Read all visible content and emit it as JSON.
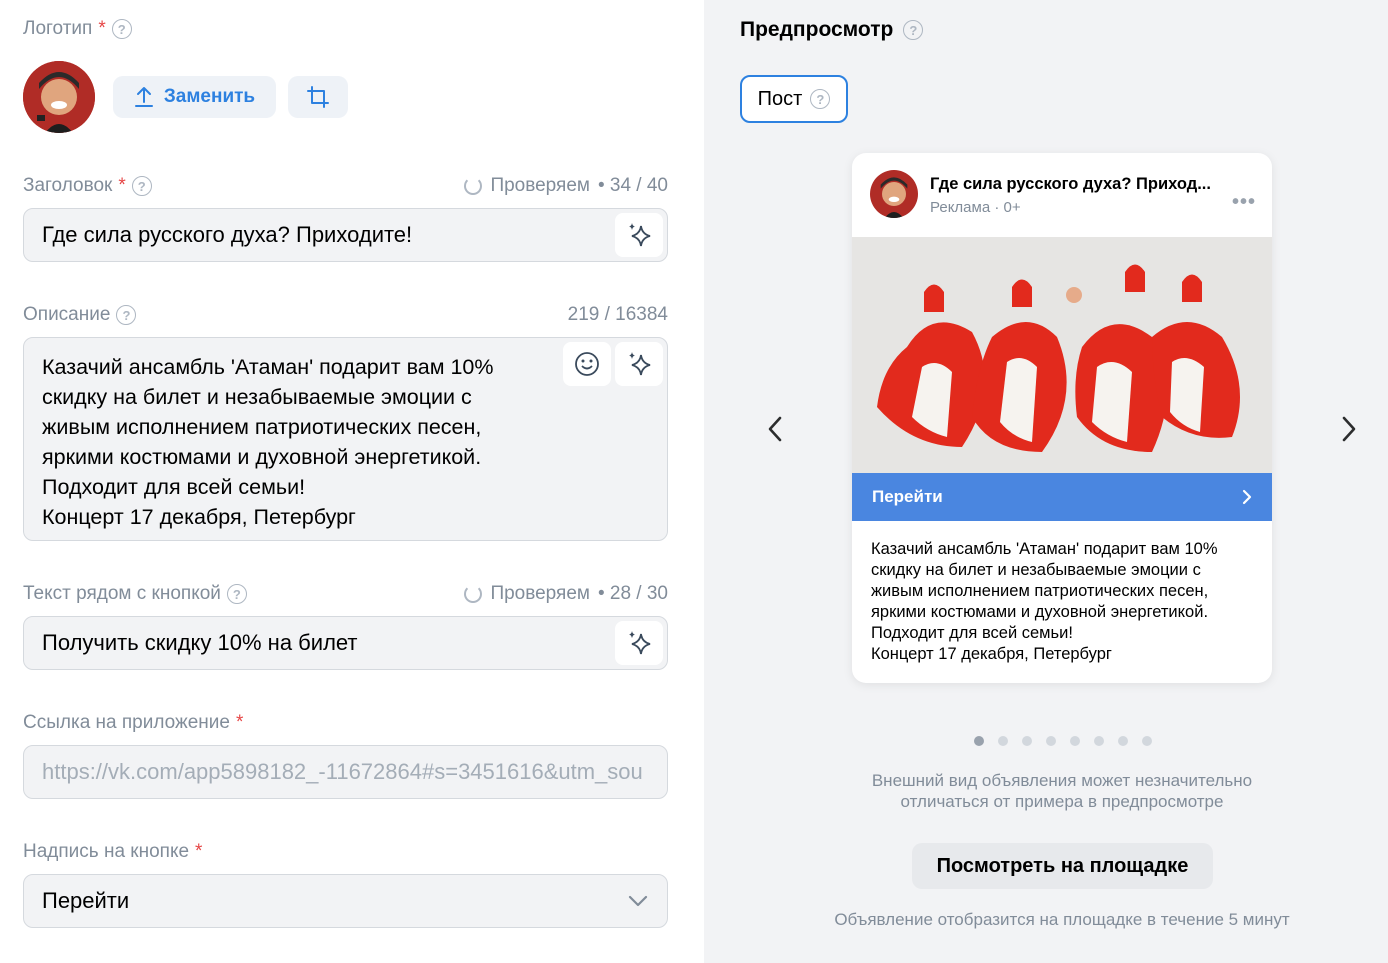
{
  "logo": {
    "label": "Логотип",
    "required": "*",
    "replace": "Заменить"
  },
  "title": {
    "label": "Заголовок",
    "required": "*",
    "status": "Проверяем",
    "count": "• 34 / 40",
    "value": "Где сила русского духа? Приходите!"
  },
  "description": {
    "label": "Описание",
    "count": "219 / 16384",
    "lines": [
      "Казачий ансамбль 'Атаман' подарит вам 10%",
      "скидку на билет и незабываемые эмоции с",
      "живым исполнением патриотических песен,",
      "яркими костюмами и духовной энергетикой.",
      "Подходит для всей семьи!",
      "Концерт 17 декабря, Петербург"
    ]
  },
  "button_text": {
    "label": "Текст рядом с кнопкой",
    "status": "Проверяем",
    "count": "• 28 / 30",
    "value": "Получить скидку 10% на билет"
  },
  "app_link": {
    "label": "Ссылка на приложение",
    "required": "*",
    "placeholder": "https://vk.com/app5898182_-11672864#s=3451616&utm_sou"
  },
  "button_caption": {
    "label": "Надпись на кнопке",
    "required": "*",
    "value": "Перейти"
  },
  "preview": {
    "title": "Предпросмотр",
    "tab": "Пост",
    "post_title": "Где сила русского духа? Приход...",
    "post_meta": "Реклама · 0+",
    "cta": "Перейти",
    "text_lines": [
      "Казачий ансамбль 'Атаман' подарит вам 10%",
      "скидку на билет и незабываемые эмоции с",
      "живым исполнением патриотических песен,",
      "яркими костюмами и духовной энергетикой.",
      "Подходит для всей семьи!",
      "Концерт 17 декабря, Петербург"
    ],
    "note1": "Внешний вид объявления может незначительно",
    "note2": "отличаться от примера в предпросмотре",
    "view_button": "Посмотреть на площадке",
    "footer": "Объявление отобразится на площадке в течение 5 минут"
  },
  "colors": {
    "accent": "#2d81e0",
    "cta": "#4a86e0",
    "required": "#e64646"
  }
}
